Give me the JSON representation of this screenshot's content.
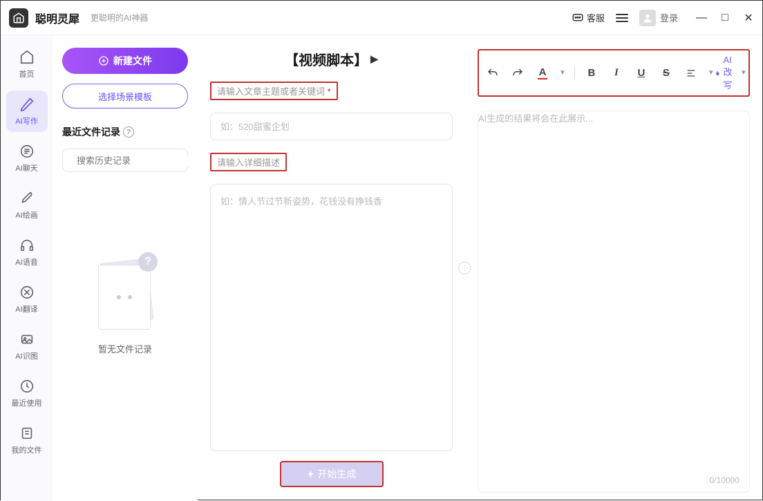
{
  "titlebar": {
    "app_name": "聪明灵犀",
    "app_subtitle": "更聪明的AI神器",
    "service_label": "客服",
    "login_label": "登录"
  },
  "sidebar": {
    "items": [
      {
        "label": "首页",
        "icon": "home"
      },
      {
        "label": "AI写作",
        "icon": "pen",
        "active": true
      },
      {
        "label": "AI聊天",
        "icon": "chat"
      },
      {
        "label": "AI绘画",
        "icon": "brush"
      },
      {
        "label": "AI语音",
        "icon": "headphone"
      },
      {
        "label": "AI翻译",
        "icon": "translate"
      },
      {
        "label": "AI识图",
        "icon": "image"
      },
      {
        "label": "最近使用",
        "icon": "clock"
      },
      {
        "label": "我的文件",
        "icon": "file"
      }
    ]
  },
  "left_panel": {
    "new_file_label": "新建文件",
    "template_label": "选择场景模板",
    "recent_label": "最近文件记录",
    "search_placeholder": "搜索历史记录",
    "empty_text": "暂无文件记录"
  },
  "center": {
    "title": "【视频脚本】",
    "field1_label": "请输入文章主题或者关键词",
    "field1_placeholder": "如：520甜蜜企划",
    "field2_label": "请输入详细描述",
    "field2_placeholder": "如：情人节过节新姿势，花钱没有挣钱香",
    "generate_label": "开始生成"
  },
  "right": {
    "ai_rewrite_label": "AI改写",
    "output_placeholder": "AI生成的结果将会在此展示...",
    "word_count": "0/10000"
  }
}
